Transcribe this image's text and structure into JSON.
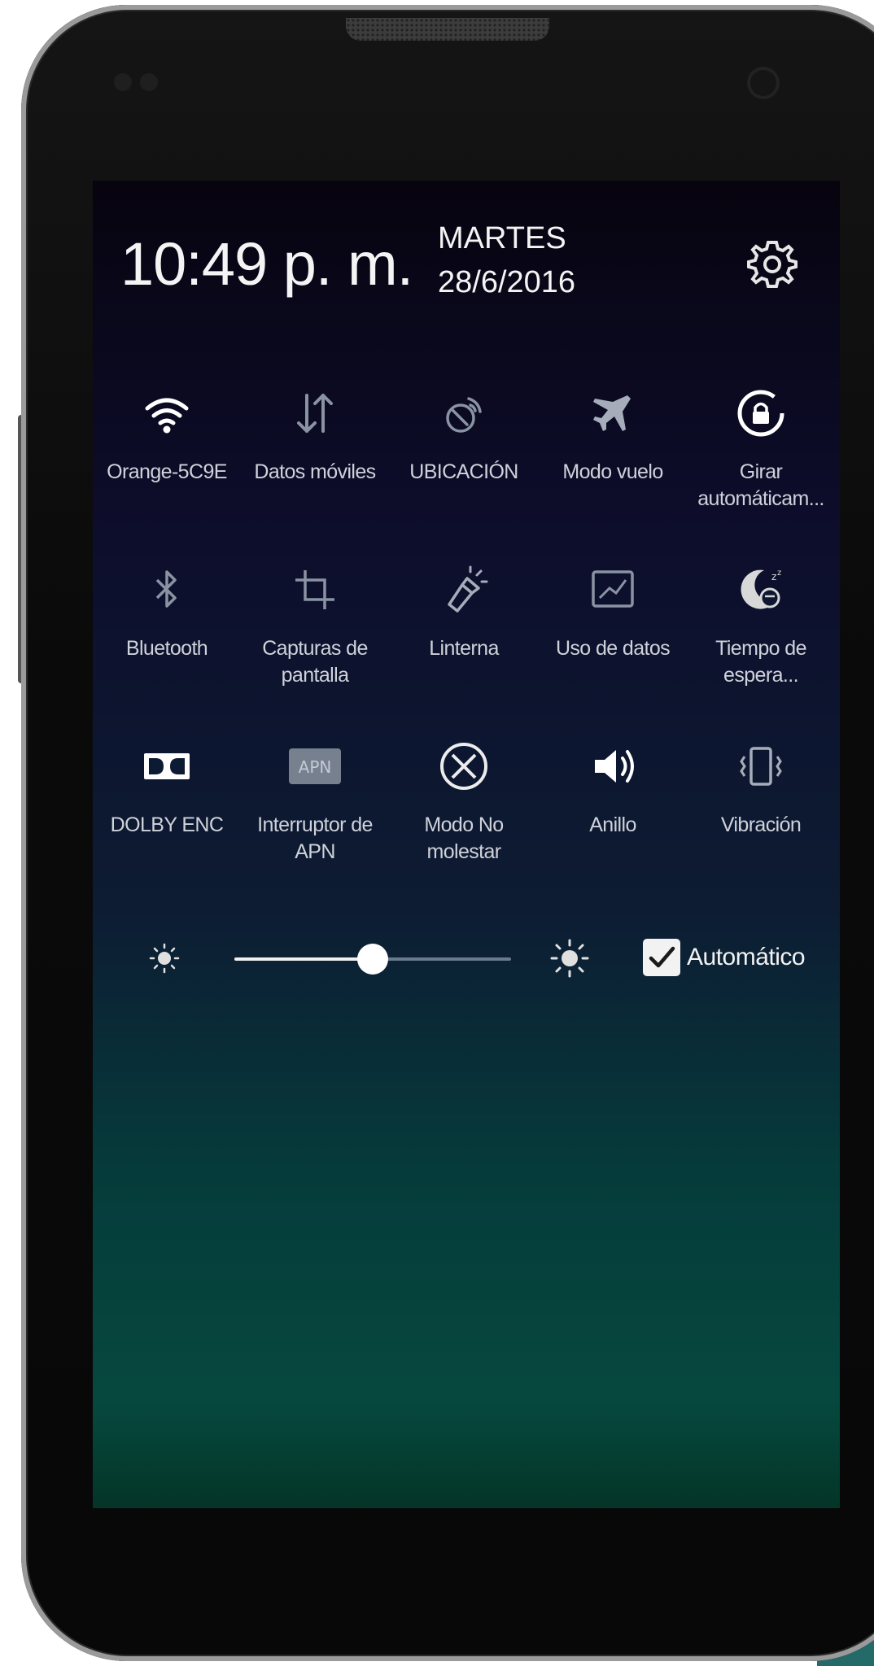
{
  "status_header": {
    "time": "10:49 p. m.",
    "day": "MARTES",
    "date": "28/6/2016",
    "settings_icon": "gear-icon"
  },
  "quick_settings": {
    "rows": [
      [
        {
          "label": "Orange-5C9E",
          "icon": "wifi-icon"
        },
        {
          "label": "Datos móviles",
          "icon": "mobile-data-icon"
        },
        {
          "label": "UBICACIÓN",
          "icon": "location-icon"
        },
        {
          "label": "Modo vuelo",
          "icon": "airplane-icon"
        },
        {
          "label": "Girar automáticam...",
          "icon": "auto-rotate-icon"
        }
      ],
      [
        {
          "label": "Bluetooth",
          "icon": "bluetooth-icon"
        },
        {
          "label": "Capturas de pantalla",
          "icon": "crop-icon"
        },
        {
          "label": "Linterna",
          "icon": "flashlight-icon"
        },
        {
          "label": "Uso de datos",
          "icon": "data-usage-icon"
        },
        {
          "label": "Tiempo de espera...",
          "icon": "sleep-timeout-icon"
        }
      ],
      [
        {
          "label": "DOLBY ENC",
          "icon": "dolby-icon"
        },
        {
          "label": "Interruptor de APN",
          "icon": "apn-icon",
          "badge": "APN"
        },
        {
          "label": "Modo No molestar",
          "icon": "do-not-disturb-icon"
        },
        {
          "label": "Anillo",
          "icon": "speaker-volume-icon"
        },
        {
          "label": "Vibración",
          "icon": "vibrate-icon"
        }
      ]
    ]
  },
  "brightness": {
    "level": 0.5,
    "auto_checked": true,
    "auto_label": "Automático"
  },
  "colors": {
    "active_icon": "#ffffff",
    "inactive_icon": "#8a93a3",
    "label": "#cfd2da"
  }
}
